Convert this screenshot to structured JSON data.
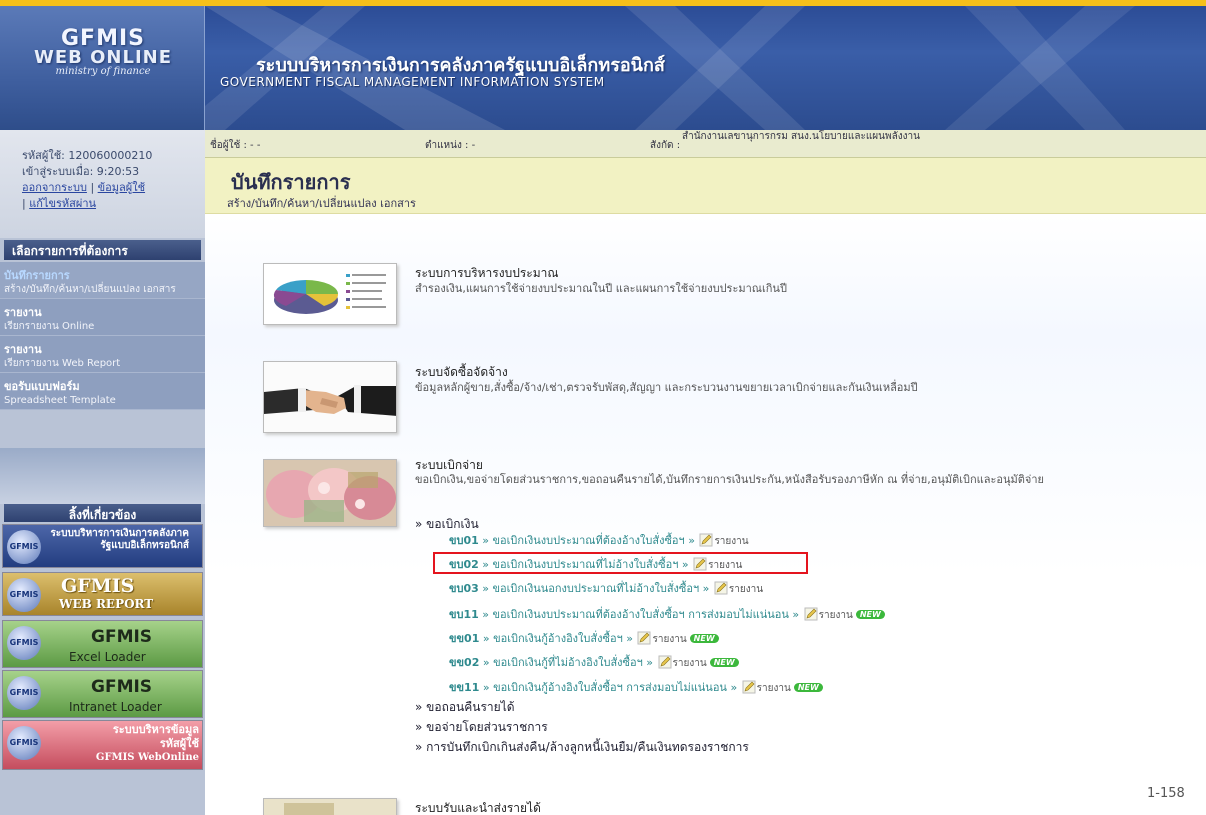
{
  "header": {
    "logo_line1": "GFMIS",
    "logo_line2": "WEB ONLINE",
    "logo_line3": "ministry of finance",
    "title_th": "ระบบบริหารการเงินการคลังภาครัฐแบบอิเล็กทรอนิกส์",
    "title_en": "GOVERNMENT FISCAL MANAGEMENT INFORMATION SYSTEM"
  },
  "userstrip": {
    "user": "ชื่อผู้ใช้ : - -",
    "position": "ตำแหน่ง :          -",
    "org_label": "สังกัด :",
    "org": "สำนักงานเลขานุการกรม สนง.นโยบายและแผนพลังงาน"
  },
  "sidebar": {
    "user_id": "รหัสผู้ใช้: 120060000210",
    "login_time": "เข้าสู่ระบบเมื่อ: 9:20:53",
    "logout": "ออกจากระบบ",
    "userinfo": "ข้อมูลผู้ใช้",
    "change_pw": "แก้ไขรหัสผ่าน",
    "menu_header": "เลือกรายการที่ต้องการ",
    "items": [
      {
        "title": "บันทึกรายการ",
        "sub": "สร้าง/บันทึก/ค้นหา/เปลี่ยนแปลง เอกสาร"
      },
      {
        "title": "รายงาน",
        "sub": "เรียกรายงาน Online"
      },
      {
        "title": "รายงาน",
        "sub": "เรียกรายงาน Web Report"
      },
      {
        "title": "ขอรับแบบฟอร์ม",
        "sub": "Spreadsheet Template"
      }
    ],
    "related_header": "ลิ้งที่เกี่ยวข้อง",
    "banners": {
      "b1": "ระบบบริหารการเงินการคลังภาครัฐแบบอิเล็กทรอนิกส์",
      "b2_line1": "GFMIS",
      "b2_line2": "WEB REPORT",
      "b3_line1": "GFMIS",
      "b3_line2": "Excel Loader",
      "b4_line1": "GFMIS",
      "b4_line2": "Intranet Loader",
      "b5_line1": "ระบบบริหารข้อมูล",
      "b5_line2": "รหัสผู้ใช้",
      "b5_line3": "GFMIS WebOnline",
      "gfmis_mark": "GFMIS"
    }
  },
  "main": {
    "title": "บันทึกรายการ",
    "subtitle": "สร้าง/บันทึก/ค้นหา/เปลี่ยนแปลง เอกสาร",
    "sections": [
      {
        "title": "ระบบการบริหารงบประมาณ",
        "desc": "สำรองเงิน,แผนการใช้จ่ายงบประมาณในปี และแผนการใช้จ่ายงบประมาณเกินปี"
      },
      {
        "title": "ระบบจัดซื้อจัดจ้าง",
        "desc": "ข้อมูลหลักผู้ขาย,สั่งซื้อ/จ้าง/เช่า,ตรวจรับพัสดุ,สัญญา และกระบวนงานขยายเวลาเบิกจ่ายและกันเงินเหลื่อมปี"
      },
      {
        "title": "ระบบเบิกจ่าย",
        "desc": "ขอเบิกเงิน,ขอจ่ายโดยส่วนราชการ,ขอถอนคืนรายได้,บันทึกรายการเงินประกัน,หนังสือรับรองภาษีหัก ณ ที่จ่าย,อนุมัติเบิกและอนุมัติจ่าย"
      },
      {
        "title": "ระบบรับและนำส่งรายได้"
      }
    ],
    "withdraw_header": "» ขอเบิกเงิน",
    "withdraw_links": [
      {
        "code": "ขบ01",
        "text": " » ขอเบิกเงินงบประมาณที่ต้องอ้างใบสั่งซื้อฯ » ",
        "report": "รายงาน",
        "new": ""
      },
      {
        "code": "ขบ02",
        "text": " » ขอเบิกเงินงบประมาณที่ไม่อ้างใบสั่งซื้อฯ » ",
        "report": "รายงาน",
        "new": ""
      },
      {
        "code": "ขบ03",
        "text": " » ขอเบิกเงินนอกงบประมาณที่ไม่อ้างใบสั่งซื้อฯ » ",
        "report": "รายงาน",
        "new": ""
      },
      {
        "code": "ขบ11",
        "text": " » ขอเบิกเงินงบประมาณที่ต้องอ้างใบสั่งซื้อฯ การส่งมอบไม่แน่นอน » ",
        "report": "รายงาน",
        "new": "NEW"
      },
      {
        "code": "ขข01",
        "text": " » ขอเบิกเงินกู้อ้างอิงใบสั่งซื้อฯ » ",
        "report": "รายงาน",
        "new": "NEW"
      },
      {
        "code": "ขข02",
        "text": " » ขอเบิกเงินกู้ที่ไม่อ้างอิงใบสั่งซื้อฯ » ",
        "report": "รายงาน",
        "new": "NEW"
      },
      {
        "code": "ขข11",
        "text": " » ขอเบิกเงินกู้อ้างอิงใบสั่งซื้อฯ การส่งมอบไม่แน่นอน » ",
        "report": "รายงาน",
        "new": "NEW"
      }
    ],
    "other_links": [
      "» ขอถอนคืนรายได้",
      "» ขอจ่ายโดยส่วนราชการ",
      "» การบันทึกเบิกเกินส่งคืน/ล้างลูกหนี้เงินยืม/คืนเงินทดรองราชการ"
    ],
    "page_number": "1-158"
  }
}
